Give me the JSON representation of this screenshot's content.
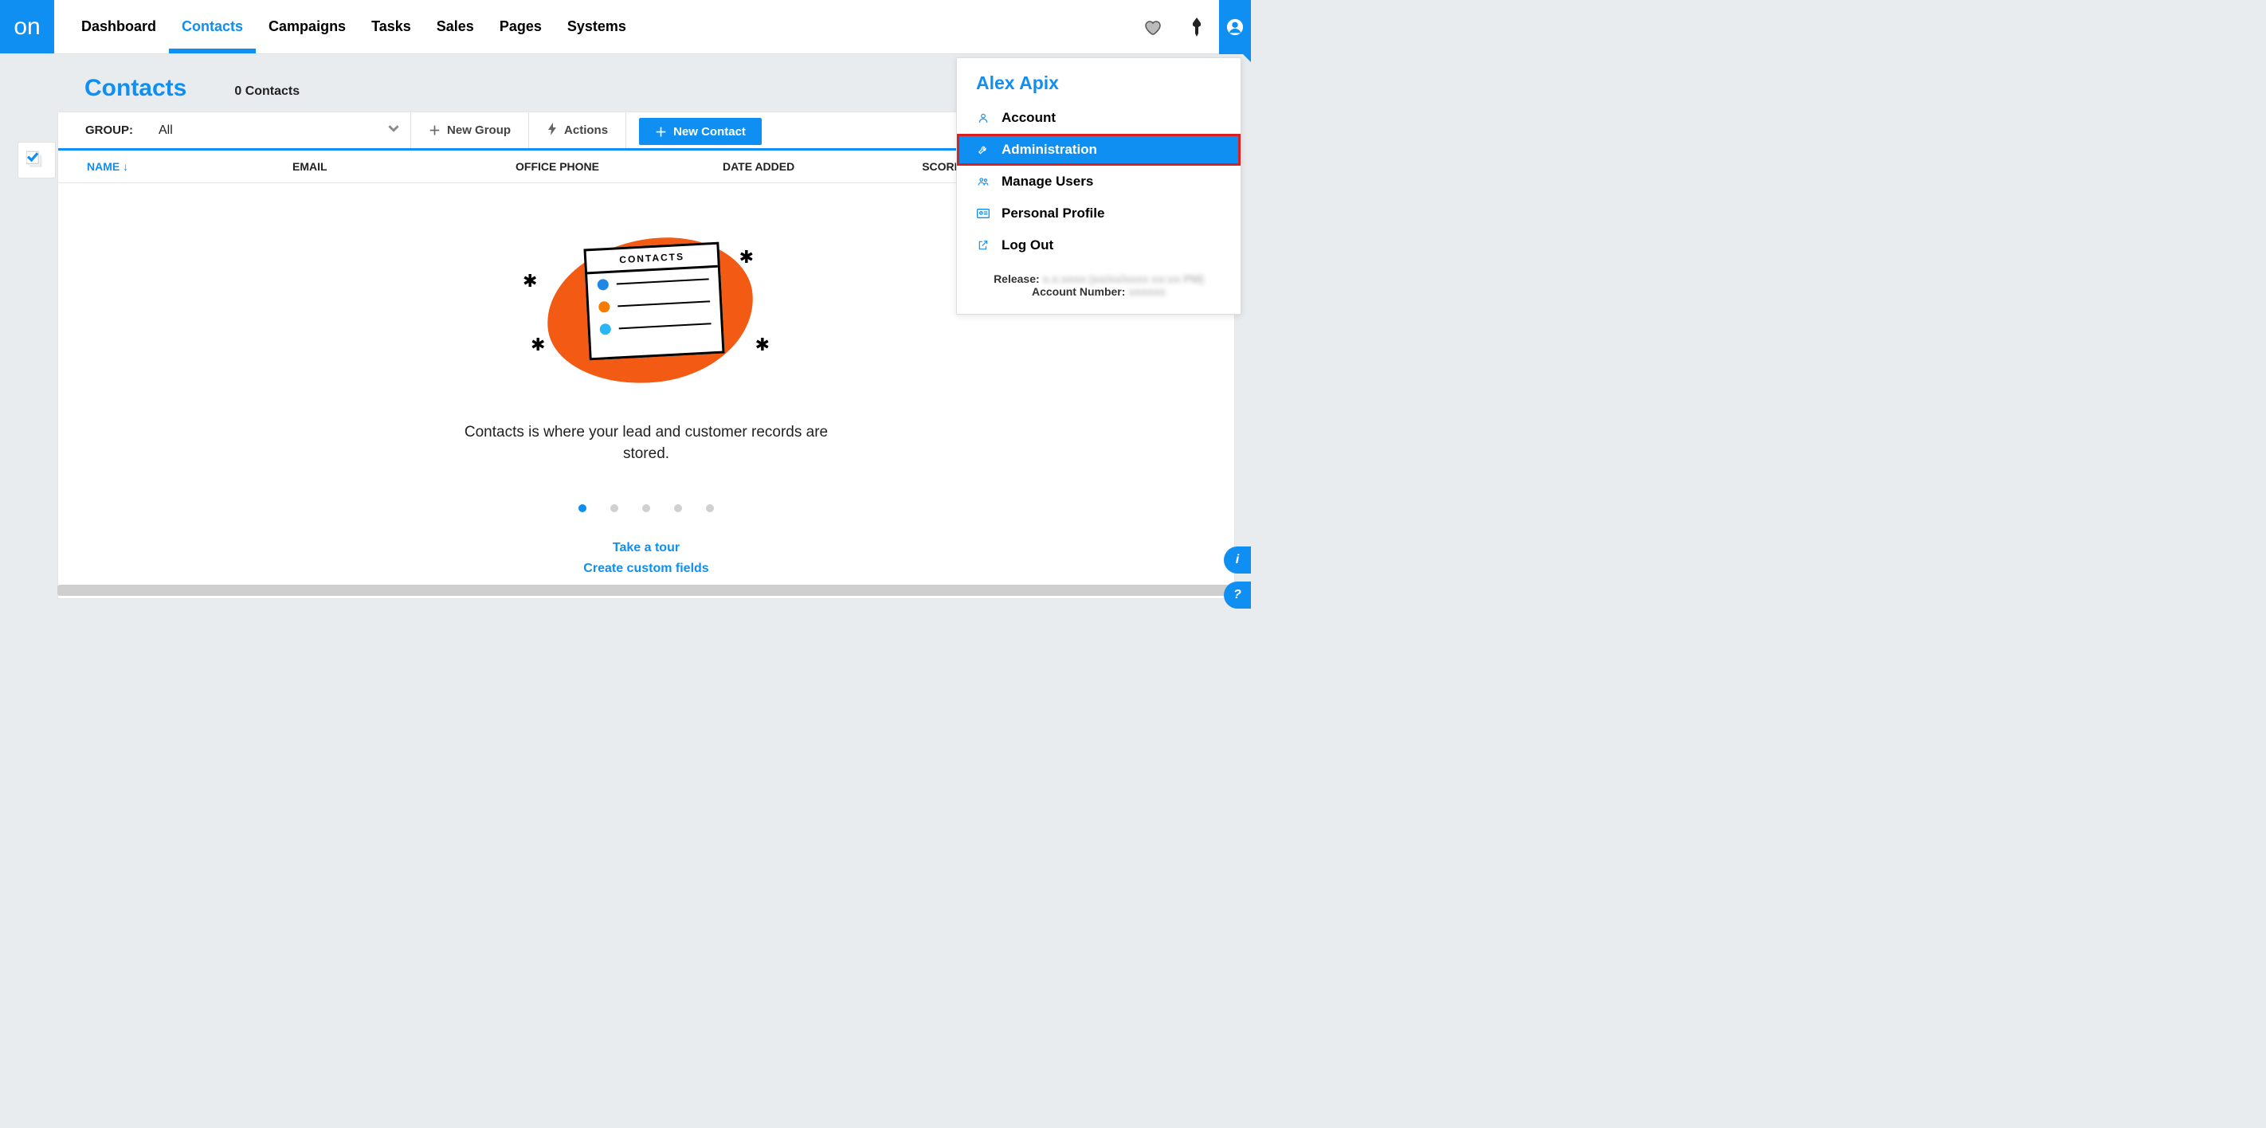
{
  "logo_text": "on",
  "nav": [
    {
      "label": "Dashboard",
      "active": false
    },
    {
      "label": "Contacts",
      "active": true
    },
    {
      "label": "Campaigns",
      "active": false
    },
    {
      "label": "Tasks",
      "active": false
    },
    {
      "label": "Sales",
      "active": false
    },
    {
      "label": "Pages",
      "active": false
    },
    {
      "label": "Systems",
      "active": false
    }
  ],
  "page": {
    "title": "Contacts",
    "count_label": "0 Contacts"
  },
  "toolbar": {
    "group_label": "GROUP:",
    "group_value": "All",
    "new_group": "New Group",
    "actions": "Actions",
    "new_contact": "New Contact"
  },
  "columns": {
    "name": "NAME",
    "email": "EMAIL",
    "phone": "OFFICE PHONE",
    "date": "DATE ADDED",
    "score": "SCORE"
  },
  "empty": {
    "card_title": "CONTACTS",
    "message": "Contacts is where your lead and customer records are stored.",
    "link_tour": "Take a tour",
    "link_fields": "Create custom fields"
  },
  "user_menu": {
    "name": "Alex Apix",
    "items": [
      {
        "label": "Account",
        "icon": "user"
      },
      {
        "label": "Administration",
        "icon": "wrench",
        "highlight": true
      },
      {
        "label": "Manage Users",
        "icon": "users"
      },
      {
        "label": "Personal Profile",
        "icon": "idcard"
      },
      {
        "label": "Log Out",
        "icon": "logout"
      }
    ],
    "release_label": "Release:",
    "release_value": "x.x.xxxx (xx/xx/xxxx xx:xx PM)",
    "account_label": "Account Number:",
    "account_value": "xxxxxx"
  }
}
